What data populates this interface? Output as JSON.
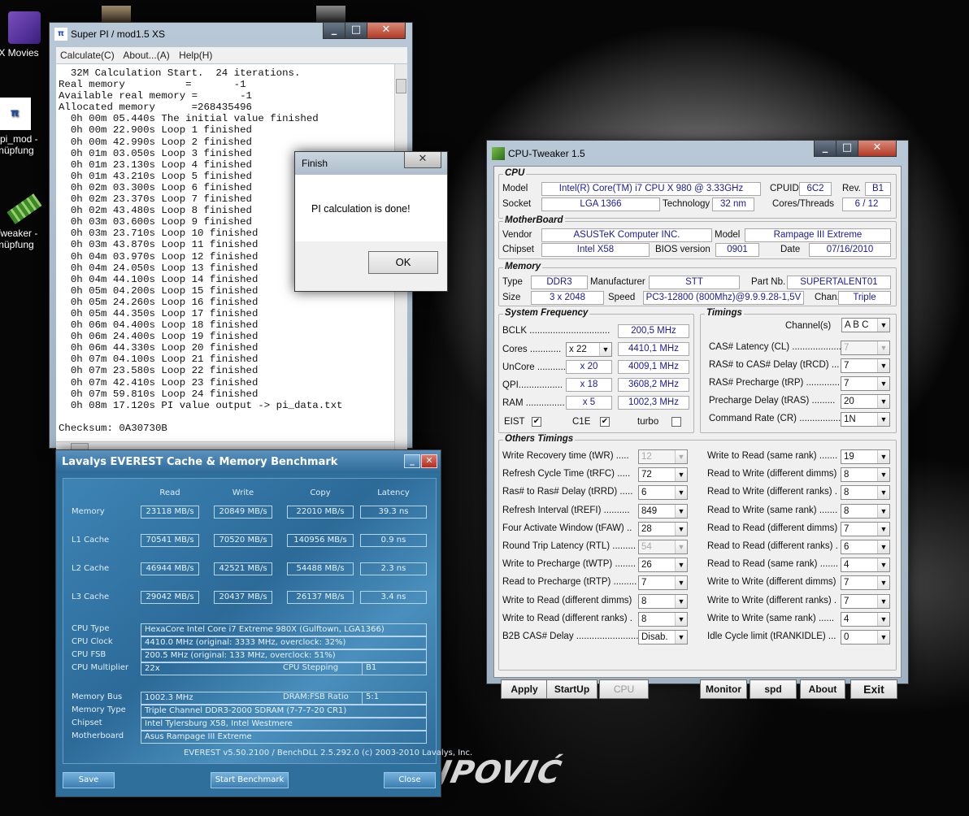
{
  "desktop": {
    "watermark": "JPOVIĆ",
    "icons": [
      {
        "name": "movies",
        "label": "X Movies",
        "icon": "movie-maker-icon"
      },
      {
        "name": "superpi",
        "label1": "_pi_mod -",
        "label2": "nüpfung",
        "icon": "superpi-icon"
      },
      {
        "name": "tweaker",
        "label1": "Tweaker -",
        "label2": "nüpfung",
        "icon": "ram-icon"
      }
    ]
  },
  "superpi": {
    "title": "Super PI / mod1.5 XS",
    "menu": [
      "Calculate(C)",
      "About...(A)",
      "Help(H)"
    ],
    "lines": [
      "  32M Calculation Start.  24 iterations.",
      "Real memory          =       -1",
      "Available real memory =       -1",
      "Allocated memory      =268435496",
      "  0h 00m 05.440s The initial value finished",
      "  0h 00m 22.900s Loop 1 finished",
      "  0h 00m 42.990s Loop 2 finished",
      "  0h 01m 03.050s Loop 3 finished",
      "  0h 01m 23.130s Loop 4 finished",
      "  0h 01m 43.210s Loop 5 finished",
      "  0h 02m 03.300s Loop 6 finished",
      "  0h 02m 23.370s Loop 7 finished",
      "  0h 02m 43.480s Loop 8 finished",
      "  0h 03m 03.600s Loop 9 finished",
      "  0h 03m 23.710s Loop 10 finished",
      "  0h 03m 43.870s Loop 11 finished",
      "  0h 04m 03.970s Loop 12 finished",
      "  0h 04m 24.050s Loop 13 finished",
      "  0h 04m 44.100s Loop 14 finished",
      "  0h 05m 04.200s Loop 15 finished",
      "  0h 05m 24.260s Loop 16 finished",
      "  0h 05m 44.350s Loop 17 finished",
      "  0h 06m 04.400s Loop 18 finished",
      "  0h 06m 24.400s Loop 19 finished",
      "  0h 06m 44.330s Loop 20 finished",
      "  0h 07m 04.100s Loop 21 finished",
      "  0h 07m 23.580s Loop 22 finished",
      "  0h 07m 42.410s Loop 23 finished",
      "  0h 07m 59.810s Loop 24 finished",
      "  0h 08m 17.120s PI value output -> pi_data.txt",
      "",
      "Checksum: 0A30730B"
    ]
  },
  "finish": {
    "title": "Finish",
    "message": "PI calculation is done!",
    "ok": "OK"
  },
  "everest": {
    "title": "Lavalys EVEREST Cache & Memory Benchmark",
    "headers": [
      "Read",
      "Write",
      "Copy",
      "Latency"
    ],
    "rows": [
      {
        "label": "Memory",
        "read": "23118 MB/s",
        "write": "20849 MB/s",
        "copy": "22010 MB/s",
        "latency": "39.3 ns"
      },
      {
        "label": "L1 Cache",
        "read": "70541 MB/s",
        "write": "70520 MB/s",
        "copy": "140956 MB/s",
        "latency": "0.9 ns"
      },
      {
        "label": "L2 Cache",
        "read": "46944 MB/s",
        "write": "42521 MB/s",
        "copy": "54488 MB/s",
        "latency": "2.3 ns"
      },
      {
        "label": "L3 Cache",
        "read": "29042 MB/s",
        "write": "20437 MB/s",
        "copy": "26137 MB/s",
        "latency": "3.4 ns"
      }
    ],
    "cpu_type_label": "CPU Type",
    "cpu_type": "HexaCore Intel Core i7 Extreme 980X  (Gulftown, LGA1366)",
    "cpu_clock_label": "CPU Clock",
    "cpu_clock": "4410.0 MHz  (original: 3333 MHz, overclock: 32%)",
    "cpu_fsb_label": "CPU FSB",
    "cpu_fsb": "200.5 MHz  (original: 133 MHz, overclock: 51%)",
    "cpu_mult_label": "CPU Multiplier",
    "cpu_mult": "22x",
    "cpu_stepping_label": "CPU Stepping",
    "cpu_stepping": "B1",
    "mem_bus_label": "Memory Bus",
    "mem_bus": "1002.3 MHz",
    "dram_ratio_label": "DRAM:FSB Ratio",
    "dram_ratio": "5:1",
    "mem_type_label": "Memory Type",
    "mem_type": "Triple Channel DDR3-2000 SDRAM  (7-7-7-20 CR1)",
    "chipset_label": "Chipset",
    "chipset": "Intel Tylersburg X58, Intel Westmere",
    "mobo_label": "Motherboard",
    "mobo": "Asus Rampage III Extreme",
    "footer": "EVEREST v5.50.2100 / BenchDLL 2.5.292.0  (c) 2003-2010 Lavalys, Inc.",
    "save": "Save",
    "start": "Start Benchmark",
    "close": "Close"
  },
  "cpu": {
    "title": "CPU-Tweaker 1.5",
    "cpu_group": "CPU",
    "model_label": "Model",
    "model": "Intel(R) Core(TM) i7 CPU      X 980  @ 3.33GHz",
    "cpuid_label": "CPUID",
    "cpuid": "6C2",
    "rev_label": "Rev.",
    "rev": "B1",
    "socket_label": "Socket",
    "socket": "LGA 1366",
    "tech_label": "Technology",
    "tech": "32 nm",
    "cores_label": "Cores/Threads",
    "cores": "6 / 12",
    "mb_group": "MotherBoard",
    "vendor_label": "Vendor",
    "vendor": "ASUSTeK Computer INC.",
    "mbmodel_label": "Model",
    "mbmodel": "Rampage III Extreme",
    "chipset_label": "Chipset",
    "chipset": "Intel X58",
    "bios_label": "BIOS version",
    "bios": "0901",
    "date_label": "Date",
    "date": "07/16/2010",
    "mem_group": "Memory",
    "type_label": "Type",
    "type": "DDR3",
    "manuf_label": "Manufacturer",
    "manuf": "STT",
    "part_label": "Part Nb.",
    "part": "SUPERTALENT01",
    "size_label": "Size",
    "size": "3 x 2048",
    "speed_label": "Speed",
    "speed": "PC3-12800 (800Mhz)@9.9.9.28-1,5V",
    "chan_label": "Chan.",
    "chan": "Triple",
    "freq_group": "System Frequency",
    "bclk_label": "BCLK ...............................",
    "bclk": "200,5 MHz",
    "cores_f_label": "Cores ............",
    "cores_mult": "x 22",
    "cores_freq": "4410,1 MHz",
    "uncore_label": "UnCore ...........",
    "uncore_mult": "x 20",
    "uncore_freq": "4009,1 MHz",
    "qpi_label": "QPI.................",
    "qpi_mult": "x 18",
    "qpi_freq": "3608,2 MHz",
    "ram_label": "RAM ...............",
    "ram_mult": "x 5",
    "ram_freq": "1002,3 MHz",
    "eist_label": "EIST",
    "c1e_label": "C1E",
    "turbo_label": "turbo",
    "check": "✔",
    "tim_group": "Timings",
    "channel_label": "Channel(s)",
    "channel": "A  B  C",
    "timings": [
      {
        "label": "CAS# Latency (CL) .....................",
        "value": "7",
        "dis": true
      },
      {
        "label": "RAS# to CAS# Delay (tRCD) ...",
        "value": "7"
      },
      {
        "label": "RAS# Precharge (tRP) ..............",
        "value": "7"
      },
      {
        "label": "Precharge Delay (tRAS) .........",
        "value": "20"
      },
      {
        "label": "Command Rate (CR) .................",
        "value": "1N"
      }
    ],
    "others_group": "Others Timings",
    "left": [
      {
        "label": "Write Recovery time (tWR) .....",
        "value": "12",
        "dis": true
      },
      {
        "label": "Refresh Cycle Time (tRFC) .....",
        "value": "72"
      },
      {
        "label": "Ras# to Ras# Delay (tRRD) .....",
        "value": "6"
      },
      {
        "label": "Refresh Interval (tREFI) ..........",
        "value": "849"
      },
      {
        "label": "Four Activate Window (tFAW) ..",
        "value": "28"
      },
      {
        "label": "Round Trip Latency (RTL) .........",
        "value": "54",
        "dis": true
      },
      {
        "label": "Write to Precharge (tWTP) ........",
        "value": "26"
      },
      {
        "label": "Read to Precharge (tRTP) .........",
        "value": "7"
      },
      {
        "label": "Write to Read (different dimms)",
        "value": "8"
      },
      {
        "label": "Write to Read (different ranks) .",
        "value": "8"
      },
      {
        "label": "B2B CAS# Delay ..........................",
        "value": "Disab."
      }
    ],
    "right": [
      {
        "label": "Write to Read (same rank) .......",
        "value": "19"
      },
      {
        "label": "Read to Write (different dimms)",
        "value": "8"
      },
      {
        "label": "Read to Write (different ranks) .",
        "value": "8"
      },
      {
        "label": "Read to Write (same rank) .......",
        "value": "8"
      },
      {
        "label": "Read to Read (different dimms)",
        "value": "7"
      },
      {
        "label": "Read to Read (different ranks) .",
        "value": "6"
      },
      {
        "label": "Read to Read (same rank) .......",
        "value": "4"
      },
      {
        "label": "Write to Write (different dimms)",
        "value": "7"
      },
      {
        "label": "Write to Write (different ranks) .",
        "value": "7"
      },
      {
        "label": "Write to Write (same rank) ......",
        "value": "4"
      },
      {
        "label": "Idle Cycle limit (tRANKIDLE) ...",
        "value": "0"
      }
    ],
    "buttons": {
      "apply": "Apply",
      "startup": "StartUp",
      "cpu": "CPU",
      "monitor": "Monitor",
      "spd": "spd",
      "about": "About",
      "exit": "Exit"
    }
  }
}
